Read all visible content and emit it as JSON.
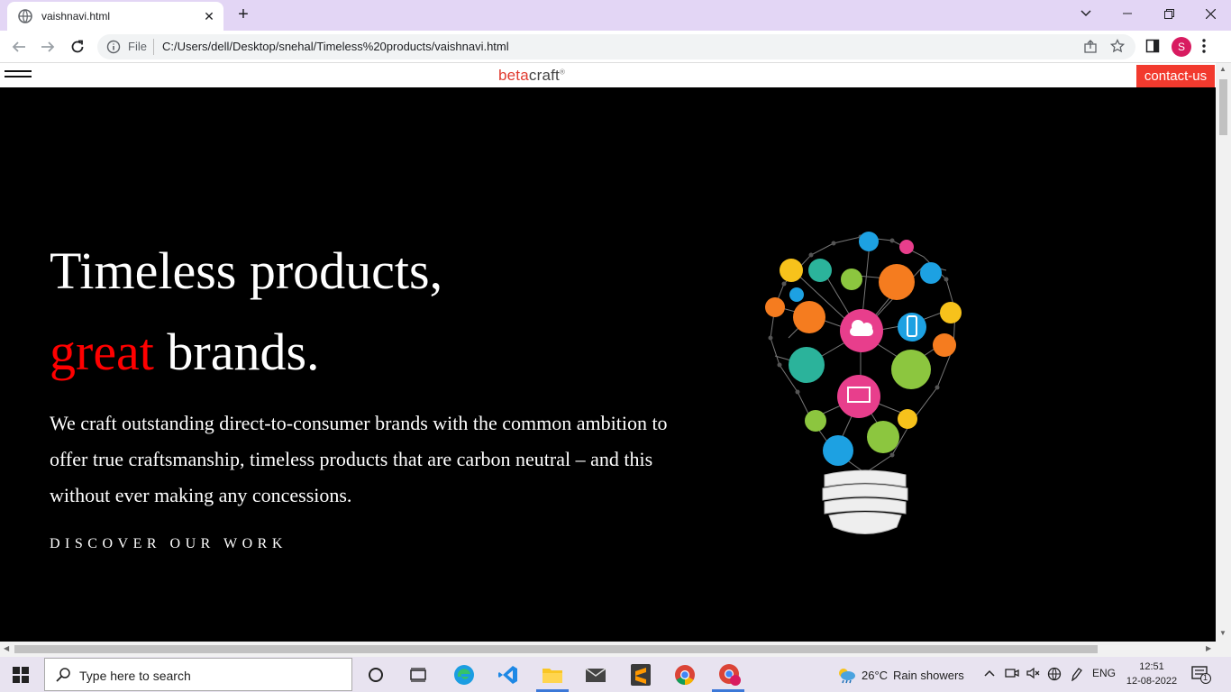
{
  "browser": {
    "tab_title": "vaishnavi.html",
    "scheme_label": "File",
    "url": "C:/Users/dell/Desktop/snehal/Timeless%20products/vaishnavi.html",
    "profile_initial": "S"
  },
  "site": {
    "logo_beta": "beta",
    "logo_craft": "craft",
    "logo_reg": "®",
    "contact_label": "contact-us",
    "hero_line1": "Timeless products,",
    "hero_accent": "great",
    "hero_line2_rest": " brands.",
    "description": "We craft outstanding direct-to-consumer brands with the common ambition to offer true craftsmanship, timeless products that are carbon neutral – and this without ever making any concessions.",
    "discover_label": "DISCOVER OUR WORK",
    "accent_color": "#ff0000",
    "contact_color": "#f23a2e"
  },
  "taskbar": {
    "search_placeholder": "Type here to search",
    "weather_temp": "26°C",
    "weather_text": "Rain showers",
    "language": "ENG",
    "time": "12:51",
    "date": "12-08-2022",
    "notification_count": "1"
  }
}
